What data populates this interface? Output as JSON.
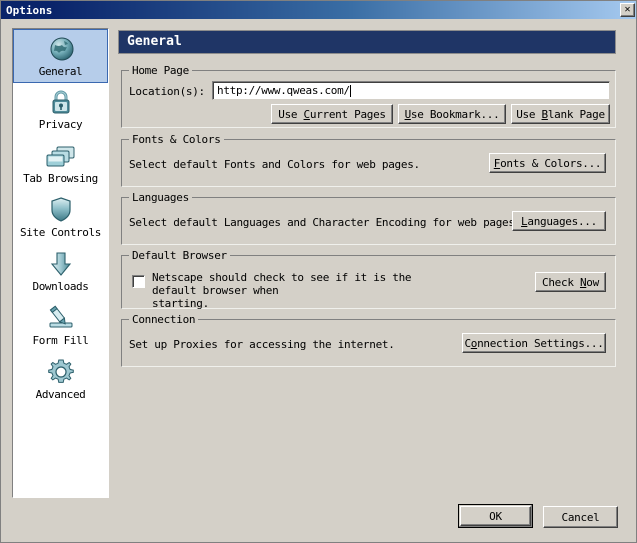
{
  "window": {
    "title": "Options",
    "close_label": "✕"
  },
  "sidebar": {
    "items": [
      {
        "label": "General",
        "icon": "globe-icon",
        "selected": true
      },
      {
        "label": "Privacy",
        "icon": "lock-icon",
        "selected": false
      },
      {
        "label": "Tab Browsing",
        "icon": "tabs-icon",
        "selected": false
      },
      {
        "label": "Site Controls",
        "icon": "shield-icon",
        "selected": false
      },
      {
        "label": "Downloads",
        "icon": "download-arrow-icon",
        "selected": false
      },
      {
        "label": "Form Fill",
        "icon": "pencil-icon",
        "selected": false
      },
      {
        "label": "Advanced",
        "icon": "gear-icon",
        "selected": false
      }
    ]
  },
  "page": {
    "header": "General",
    "home_page": {
      "legend": "Home Page",
      "location_label": "Location(s):",
      "location_value": "http://www.qweas.com/",
      "buttons": {
        "use_current_pages": "Use Current Pages",
        "use_bookmark": "Use Bookmark...",
        "use_blank_page": "Use Blank Page"
      }
    },
    "fonts_colors": {
      "legend": "Fonts & Colors",
      "description": "Select default Fonts and Colors for web pages.",
      "button": "Fonts & Colors..."
    },
    "languages": {
      "legend": "Languages",
      "description": "Select default Languages and Character Encoding for web pages.",
      "button": "Languages..."
    },
    "default_browser": {
      "legend": "Default Browser",
      "checkbox_line1": "Netscape should check to see if it is the default browser when",
      "checkbox_line2": "starting.",
      "checkbox_checked": false,
      "button": "Check Now"
    },
    "connection": {
      "legend": "Connection",
      "description": "Set up Proxies for accessing the internet.",
      "button": "Connection Settings..."
    }
  },
  "footer": {
    "ok": "OK",
    "cancel": "Cancel"
  },
  "colors": {
    "titlebar_start": "#0a246a",
    "titlebar_end": "#a6caf0",
    "header_banner": "#1f3566",
    "dialog_face": "#d4d0c8",
    "selection": "#b6cdea",
    "icon_teal": "#2e7d8e"
  }
}
